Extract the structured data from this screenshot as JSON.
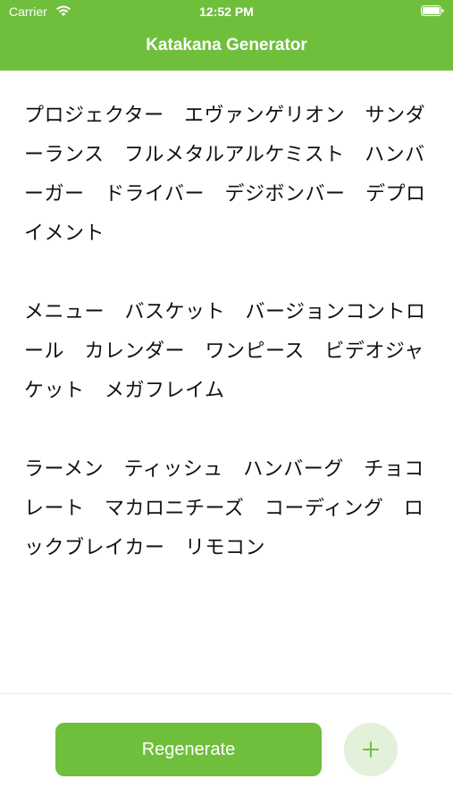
{
  "status_bar": {
    "carrier": "Carrier",
    "time": "12:52 PM",
    "wifi_icon": "wifi-icon",
    "battery_icon": "battery-full-icon"
  },
  "header": {
    "title": "Katakana Generator",
    "background_color": "#6fbf3c"
  },
  "paragraphs": [
    "プロジェクター　エヴァンゲリオン　サンダーランス　フルメタルアルケミスト　ハンバーガー　ドライバー　デジボンバー　デプロイメント",
    "メニュー　バスケット　バージョンコントロール　カレンダー　ワンピース　ビデオジャケット　メガフレイム",
    "ラーメン　ティッシュ　ハンバーグ　チョコレート　マカロニチーズ　コーディング　ロックブレイカー　リモコン"
  ],
  "footer": {
    "regenerate_label": "Regenerate",
    "add_icon": "plus-icon",
    "accent_color": "#6fbf3c",
    "add_button_color": "#e3f0da"
  }
}
